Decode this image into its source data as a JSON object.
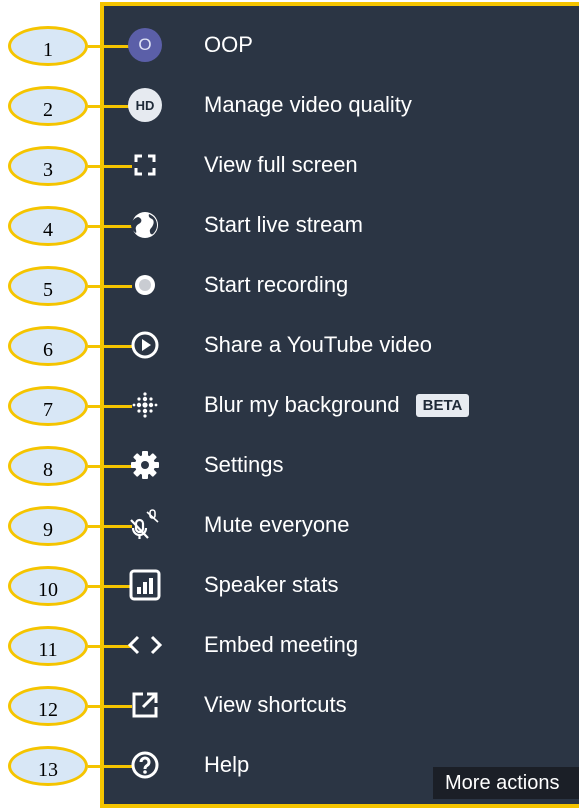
{
  "menu": {
    "items": [
      {
        "label": "OOP",
        "icon": "avatar-initial",
        "avatar_text": "O"
      },
      {
        "label": "Manage video quality",
        "icon": "hd-icon",
        "icon_text": "HD"
      },
      {
        "label": "View full screen",
        "icon": "fullscreen-icon"
      },
      {
        "label": "Start live stream",
        "icon": "globe-icon"
      },
      {
        "label": "Start recording",
        "icon": "record-icon"
      },
      {
        "label": "Share a YouTube video",
        "icon": "play-circle-icon"
      },
      {
        "label": "Blur my background",
        "icon": "blur-icon",
        "badge": "BETA"
      },
      {
        "label": "Settings",
        "icon": "gear-icon"
      },
      {
        "label": "Mute everyone",
        "icon": "mute-everyone-icon"
      },
      {
        "label": "Speaker stats",
        "icon": "stats-icon"
      },
      {
        "label": "Embed meeting",
        "icon": "code-icon"
      },
      {
        "label": "View shortcuts",
        "icon": "external-link-icon"
      },
      {
        "label": "Help",
        "icon": "help-icon"
      }
    ]
  },
  "callouts": [
    "1",
    "2",
    "3",
    "4",
    "5",
    "6",
    "7",
    "8",
    "9",
    "10",
    "11",
    "12",
    "13"
  ],
  "tooltip": {
    "text": "More actions"
  },
  "colors": {
    "panel": "#2b3544",
    "accent": "#f5c400",
    "callout_fill": "#d8e7f6",
    "avatar": "#5b5fa8"
  }
}
